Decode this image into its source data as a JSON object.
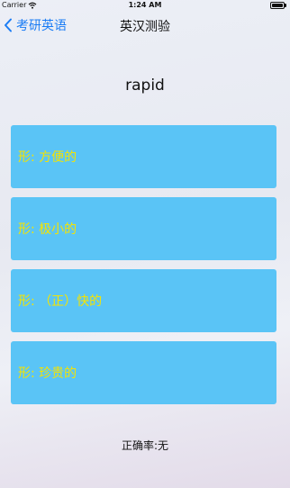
{
  "status_bar": {
    "carrier": "Carrier",
    "time": "1:24 AM"
  },
  "nav": {
    "back_label": "考研英语",
    "title": "英汉测验"
  },
  "quiz": {
    "word": "rapid",
    "options": [
      "形: 方便的",
      "形: 极小的",
      "形: （正）快的",
      "形: 珍贵的"
    ],
    "accuracy": "正确率:无"
  },
  "colors": {
    "accent": "#1a7cf5",
    "option_bg": "#5ac4f6",
    "option_text": "#f5e400"
  }
}
